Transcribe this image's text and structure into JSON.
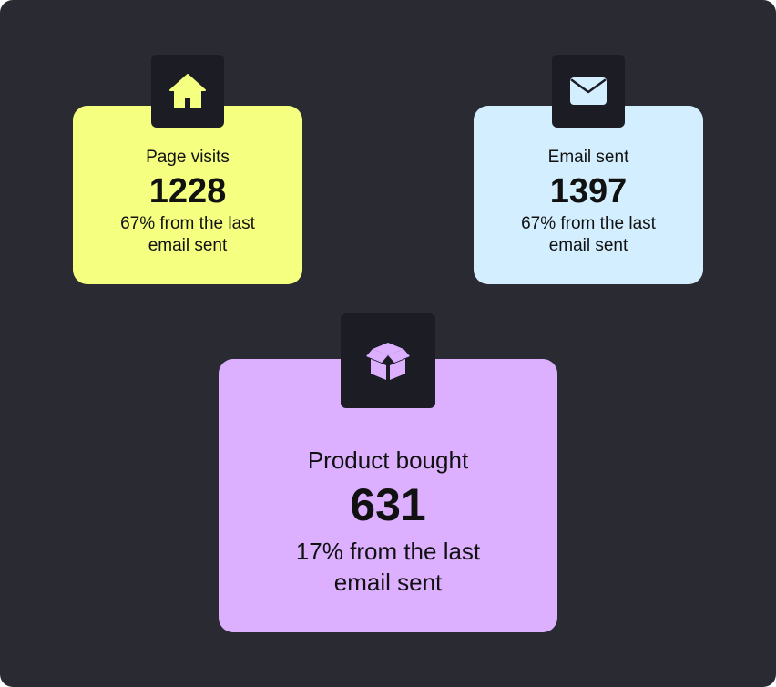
{
  "colors": {
    "background": "#2a2a33",
    "icon_tile": "#1c1c24",
    "visits_card": "#f5ff80",
    "email_card": "#d3efff",
    "product_card": "#dcb0ff",
    "visits_icon": "#f5ff80",
    "email_icon": "#d3efff",
    "product_icon": "#dcb0ff"
  },
  "cards": {
    "visits": {
      "icon": "home-icon",
      "label": "Page visits",
      "value": "1228",
      "sub": "67% from the last email sent"
    },
    "email": {
      "icon": "envelope-icon",
      "label": "Email sent",
      "value": "1397",
      "sub": "67% from the last email sent"
    },
    "product": {
      "icon": "box-icon",
      "label": "Product bought",
      "value": "631",
      "sub": "17% from the last email sent"
    }
  }
}
